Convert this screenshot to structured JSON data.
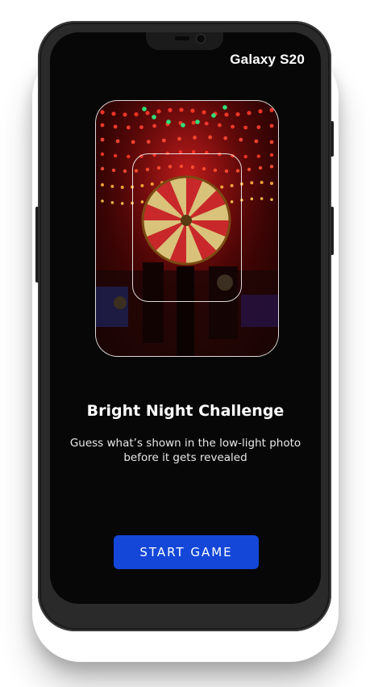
{
  "device": {
    "brand_label": "Galaxy S20"
  },
  "photo": {
    "description_icon": "fairground-low-light-photo"
  },
  "content": {
    "title": "Bright Night Challenge",
    "subtitle_line1": "Guess what’s shown in the low-light photo",
    "subtitle_line2": "before it gets revealed"
  },
  "actions": {
    "start_label": "START GAME"
  },
  "colors": {
    "accent": "#1447d8",
    "screen_bg": "#070707"
  }
}
